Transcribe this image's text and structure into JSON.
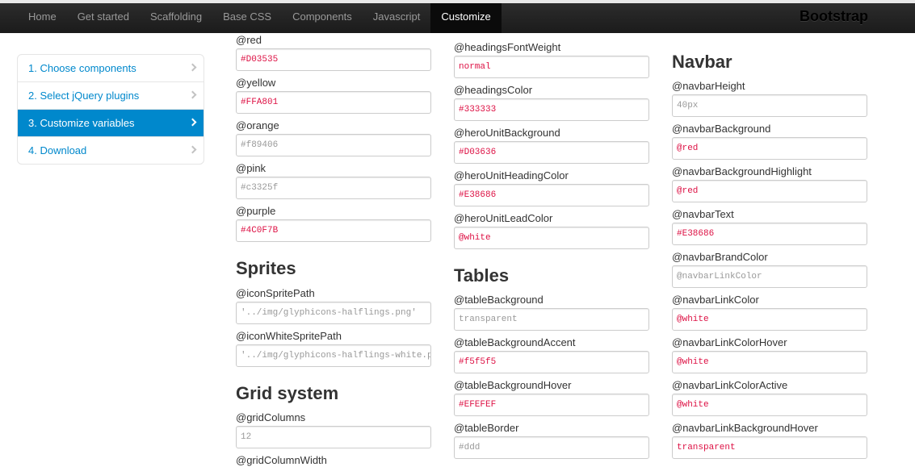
{
  "topbar": {
    "nav": [
      "Home",
      "Get started",
      "Scaffolding",
      "Base CSS",
      "Components",
      "Javascript",
      "Customize"
    ],
    "active_index": 6,
    "brand": "Bootstrap"
  },
  "sidenav": {
    "items": [
      {
        "label": "1. Choose components"
      },
      {
        "label": "2. Select jQuery plugins"
      },
      {
        "label": "3. Customize variables"
      },
      {
        "label": "4. Download"
      }
    ],
    "active_index": 2
  },
  "columns": {
    "col1": {
      "colors": [
        {
          "label": "@red",
          "value": "#D03535",
          "placeholder": ""
        },
        {
          "label": "@yellow",
          "value": "#FFA801",
          "placeholder": ""
        },
        {
          "label": "@orange",
          "value": "",
          "placeholder": "#f89406"
        },
        {
          "label": "@pink",
          "value": "",
          "placeholder": "#c3325f"
        },
        {
          "label": "@purple",
          "value": "#4C0F7B",
          "placeholder": ""
        }
      ],
      "sprites_heading": "Sprites",
      "sprites": [
        {
          "label": "@iconSpritePath",
          "value": "",
          "placeholder": "'../img/glyphicons-halflings.png'"
        },
        {
          "label": "@iconWhiteSpritePath",
          "value": "",
          "placeholder": "'../img/glyphicons-halflings-white.png'"
        }
      ],
      "grid_heading": "Grid system",
      "grid": [
        {
          "label": "@gridColumns",
          "value": "",
          "placeholder": "12"
        },
        {
          "label": "@gridColumnWidth",
          "value": "",
          "placeholder": ""
        }
      ]
    },
    "col2": {
      "typography": [
        {
          "label": "@headingsFontWeight",
          "value": "normal",
          "placeholder": ""
        },
        {
          "label": "@headingsColor",
          "value": "#333333",
          "placeholder": ""
        },
        {
          "label": "@heroUnitBackground",
          "value": "#D03636",
          "placeholder": ""
        },
        {
          "label": "@heroUnitHeadingColor",
          "value": "#E38686",
          "placeholder": ""
        },
        {
          "label": "@heroUnitLeadColor",
          "value": "@white",
          "placeholder": ""
        }
      ],
      "tables_heading": "Tables",
      "tables": [
        {
          "label": "@tableBackground",
          "value": "",
          "placeholder": "transparent"
        },
        {
          "label": "@tableBackgroundAccent",
          "value": "#f5f5f5",
          "placeholder": ""
        },
        {
          "label": "@tableBackgroundHover",
          "value": "#EFEFEF",
          "placeholder": ""
        },
        {
          "label": "@tableBorder",
          "value": "",
          "placeholder": "#ddd"
        }
      ]
    },
    "col3": {
      "navbar_heading": "Navbar",
      "navbar": [
        {
          "label": "@navbarHeight",
          "value": "",
          "placeholder": "40px"
        },
        {
          "label": "@navbarBackground",
          "value": "@red",
          "placeholder": ""
        },
        {
          "label": "@navbarBackgroundHighlight",
          "value": "@red",
          "placeholder": ""
        },
        {
          "label": "@navbarText",
          "value": "#E38686",
          "placeholder": ""
        },
        {
          "label": "@navbarBrandColor",
          "value": "",
          "placeholder": "@navbarLinkColor"
        },
        {
          "label": "@navbarLinkColor",
          "value": "@white",
          "placeholder": ""
        },
        {
          "label": "@navbarLinkColorHover",
          "value": "@white",
          "placeholder": ""
        },
        {
          "label": "@navbarLinkColorActive",
          "value": "@white",
          "placeholder": ""
        },
        {
          "label": "@navbarLinkBackgroundHover",
          "value": "transparent",
          "placeholder": ""
        }
      ]
    }
  },
  "colors": {
    "value_text": "#dd1144",
    "placeholder_text": "#999999",
    "accent": "#0088cc"
  }
}
